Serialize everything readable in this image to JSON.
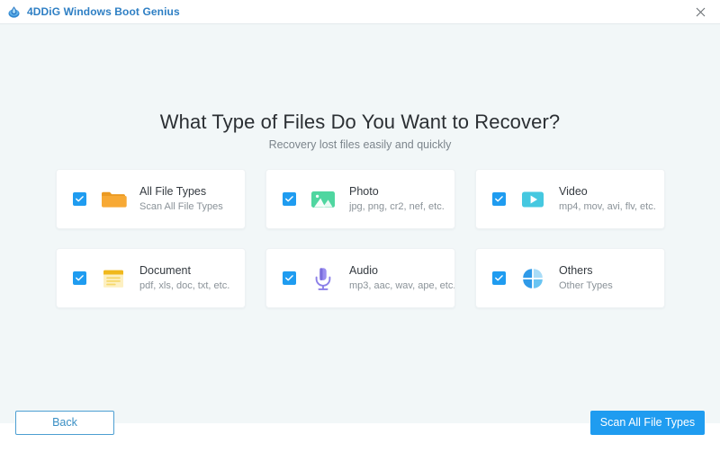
{
  "window": {
    "title": "4DDiG Windows Boot Genius",
    "logo_icon": "4ddig-droplet-logo",
    "close_icon": "close-icon"
  },
  "main": {
    "heading": "What Type of Files Do You Want to Recover?",
    "subheading": "Recovery lost files easily and quickly",
    "file_types": [
      {
        "id": "all-file-types",
        "title": "All File Types",
        "subtitle": "Scan All File Types",
        "icon": "folder-icon",
        "color": "#f5a623",
        "checked": true
      },
      {
        "id": "photo",
        "title": "Photo",
        "subtitle": "jpg, png, cr2, nef, etc.",
        "icon": "image-icon",
        "color": "#4fd6a0",
        "checked": true
      },
      {
        "id": "video",
        "title": "Video",
        "subtitle": "mp4, mov, avi, flv, etc.",
        "icon": "video-play-icon",
        "color": "#45c8e0",
        "checked": true
      },
      {
        "id": "document",
        "title": "Document",
        "subtitle": "pdf, xls, doc, txt, etc.",
        "icon": "document-icon",
        "color": "#f5c518",
        "checked": true
      },
      {
        "id": "audio",
        "title": "Audio",
        "subtitle": "mp3, aac, wav, ape, etc.",
        "icon": "microphone-icon",
        "color": "#8b7fe8",
        "checked": true
      },
      {
        "id": "others",
        "title": "Others",
        "subtitle": "Other Types",
        "icon": "four-petals-icon",
        "color": "#2196f3",
        "checked": true
      }
    ]
  },
  "footer": {
    "back_label": "Back",
    "scan_label": "Scan All File Types"
  },
  "colors": {
    "accent": "#1f9cf0",
    "title_text": "#2e7fc4",
    "background": "#f2f7f8",
    "card_background": "#ffffff",
    "heading_text": "#2b2f33",
    "subtext": "#7c858c"
  }
}
